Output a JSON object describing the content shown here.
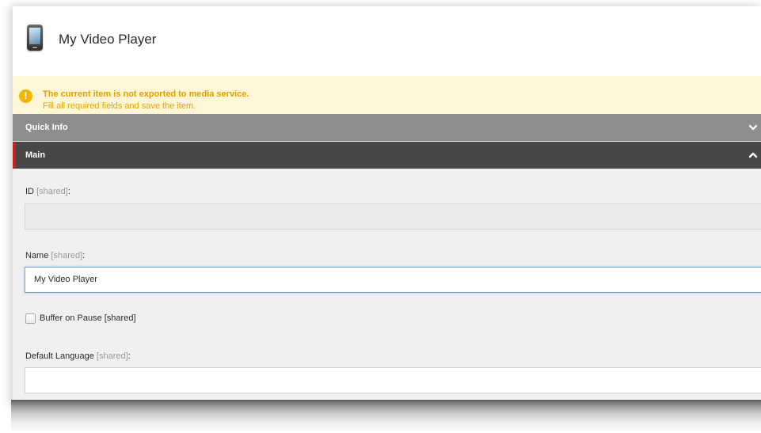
{
  "header": {
    "title": "My Video Player",
    "icon": "mobile-device-icon"
  },
  "warning": {
    "icon": "exclamation-icon",
    "title": "The current item is not exported to media service.",
    "message": "Fill all required fields and save the item.",
    "color": "#e0a000",
    "background": "#fff6d6"
  },
  "sections": {
    "quick_info": {
      "label": "Quick Info",
      "icon": "chevron-down-icon",
      "background": "#8d8d8d"
    },
    "main": {
      "label": "Main",
      "icon": "chevron-up-icon",
      "background": "#474747",
      "accent": "#c9211e"
    }
  },
  "fields": {
    "id": {
      "label": "ID",
      "shared": "[shared]",
      "suffix": ":",
      "value": ""
    },
    "name": {
      "label": "Name",
      "shared": "[shared]",
      "suffix": ":",
      "value": "My Video Player"
    },
    "buffer_on_pause": {
      "label": "Buffer on Pause",
      "shared": "[shared]",
      "checked": false
    },
    "default_language": {
      "label": "Default Language",
      "shared": "[shared]",
      "suffix": ":",
      "value": ""
    }
  }
}
